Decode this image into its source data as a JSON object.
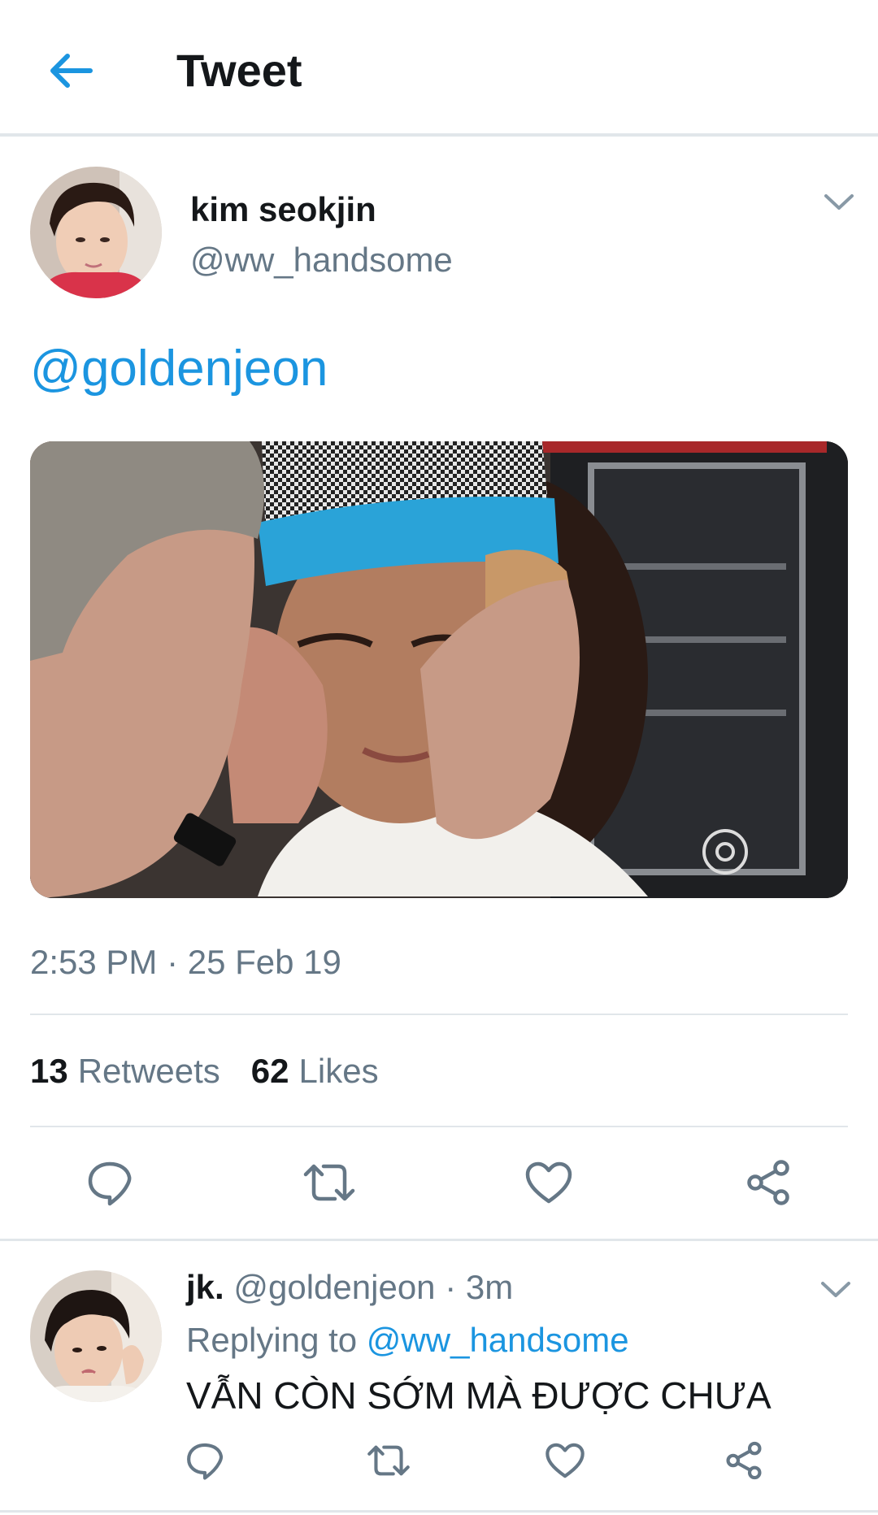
{
  "header": {
    "title": "Tweet",
    "back_icon": "arrow-left-icon",
    "accent": "#1b95e0"
  },
  "tweet": {
    "author_name": "kim seokjin",
    "author_handle": "@ww_handsome",
    "text": "@goldenjeon",
    "media_icon": "photo",
    "timestamp": "2:53 PM · 25 Feb 19",
    "retweets_count": "13",
    "retweets_label": "Retweets",
    "likes_count": "62",
    "likes_label": "Likes",
    "actions": [
      "reply-icon",
      "retweet-icon",
      "like-icon",
      "share-icon"
    ]
  },
  "reply": {
    "author_name": "jk.",
    "author_handle": "@goldenjeon",
    "separator": " · ",
    "time": "3m",
    "replying_prefix": "Replying to",
    "replying_handle": "@ww_handsome",
    "text": "VẪN CÒN SỚM MÀ ĐƯỢC CHƯA",
    "actions": [
      "reply-icon",
      "retweet-icon",
      "like-icon",
      "share-icon"
    ]
  },
  "colors": {
    "link": "#1b95e0",
    "secondary_text": "#657786",
    "primary_text": "#14171a",
    "divider": "#e1e6ea"
  }
}
